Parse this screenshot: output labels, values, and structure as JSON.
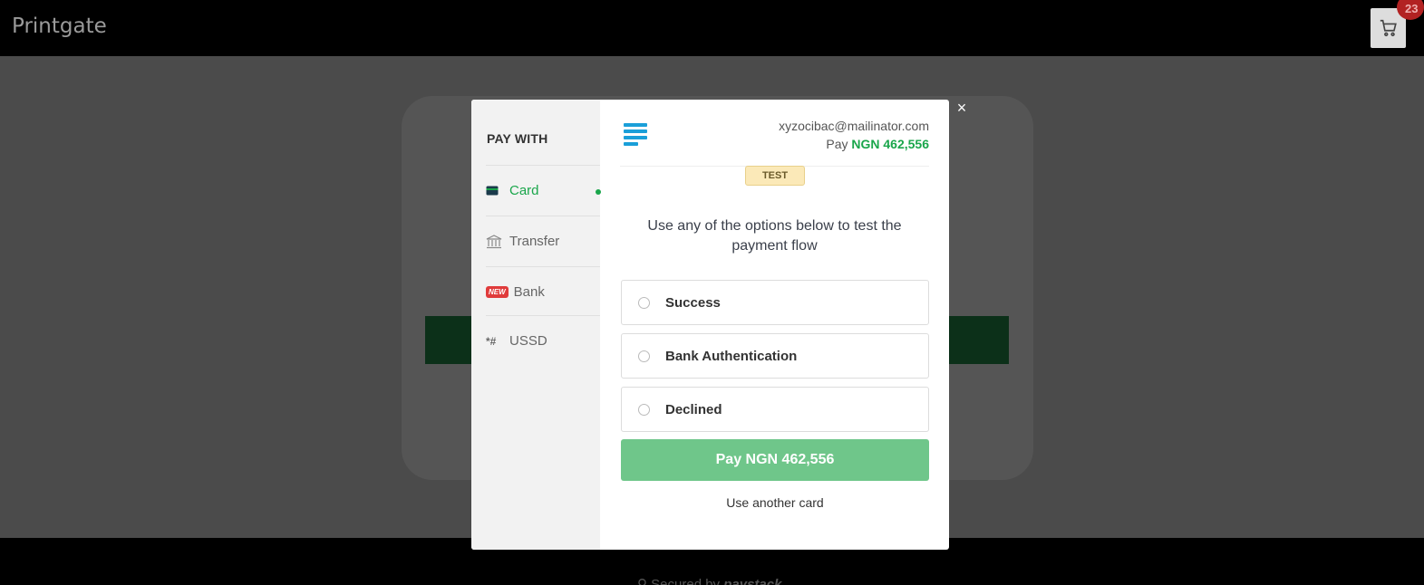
{
  "header": {
    "brand": "Printgate",
    "cart_count": "23"
  },
  "footer": {
    "secured_by": "Secured by",
    "provider": "paystack"
  },
  "modal": {
    "pay_with_title": "PAY WITH",
    "methods": [
      {
        "label": "Card",
        "icon": "card-icon",
        "active": true
      },
      {
        "label": "Transfer",
        "icon": "bank-building-icon",
        "active": false
      },
      {
        "label": "Bank",
        "icon": "new-badge",
        "badge": "NEW",
        "active": false
      },
      {
        "label": "USSD",
        "icon": "ussd-icon",
        "glyph": "*#",
        "active": false
      }
    ],
    "email": "xyzocibac@mailinator.com",
    "pay_prefix": "Pay",
    "amount": "NGN 462,556",
    "test_badge": "TEST",
    "instruction": "Use any of the options below to test the payment flow",
    "options": [
      {
        "label": "Success"
      },
      {
        "label": "Bank Authentication"
      },
      {
        "label": "Declined"
      }
    ],
    "pay_button": "Pay NGN 462,556",
    "use_another_card": "Use another card",
    "close_glyph": "×"
  },
  "colors": {
    "accent_green": "#1aa64b",
    "pay_button_green": "#6fc68a",
    "overlay": "#4b4b4b"
  }
}
